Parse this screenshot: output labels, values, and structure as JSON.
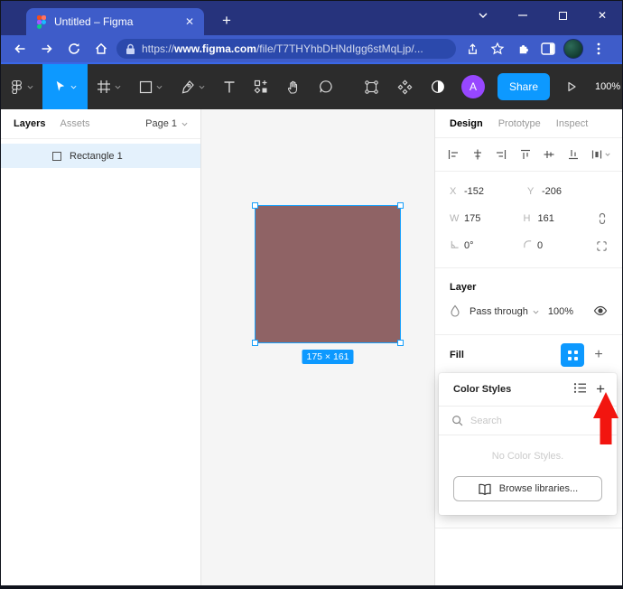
{
  "browser": {
    "tab_title": "Untitled – Figma",
    "url": {
      "scheme": "https://",
      "domain": "www.figma.com",
      "path": "/file/T7THYhbDHNdIgg6stMqLjp/..."
    }
  },
  "figma": {
    "toolbar": {
      "share_label": "Share",
      "zoom_label": "100%",
      "avatar_initial": "A"
    }
  },
  "sidebar": {
    "layers_label": "Layers",
    "assets_label": "Assets",
    "page_label": "Page 1",
    "layers": [
      {
        "name": "Rectangle 1"
      }
    ]
  },
  "canvas": {
    "size_label": "175 × 161"
  },
  "inspector": {
    "tabs": [
      {
        "label": "Design"
      },
      {
        "label": "Prototype"
      },
      {
        "label": "Inspect"
      }
    ],
    "position": {
      "x_label": "X",
      "x_value": "-152",
      "y_label": "Y",
      "y_value": "-206",
      "w_label": "W",
      "w_value": "175",
      "h_label": "H",
      "h_value": "161",
      "rotation_value": "0°",
      "radius_value": "0"
    },
    "layer": {
      "title": "Layer",
      "blend_mode": "Pass through",
      "opacity": "100%"
    },
    "fill": {
      "title": "Fill"
    }
  },
  "popup": {
    "title": "Color Styles",
    "search_placeholder": "Search",
    "empty_message": "No Color Styles.",
    "browse_label": "Browse libraries..."
  },
  "colors": {
    "accent_blue": "#0d99ff",
    "selection_blue": "#18a0fb",
    "rectangle_fill": "#8f6365",
    "arrow_red": "#f2150f",
    "titlebar": "#26337c",
    "browser_toolbar": "#3e5cc9",
    "urlbar": "#2b49ac",
    "figma_toolbar": "#2c2c2c",
    "avatar_purple": "#9747ff"
  }
}
